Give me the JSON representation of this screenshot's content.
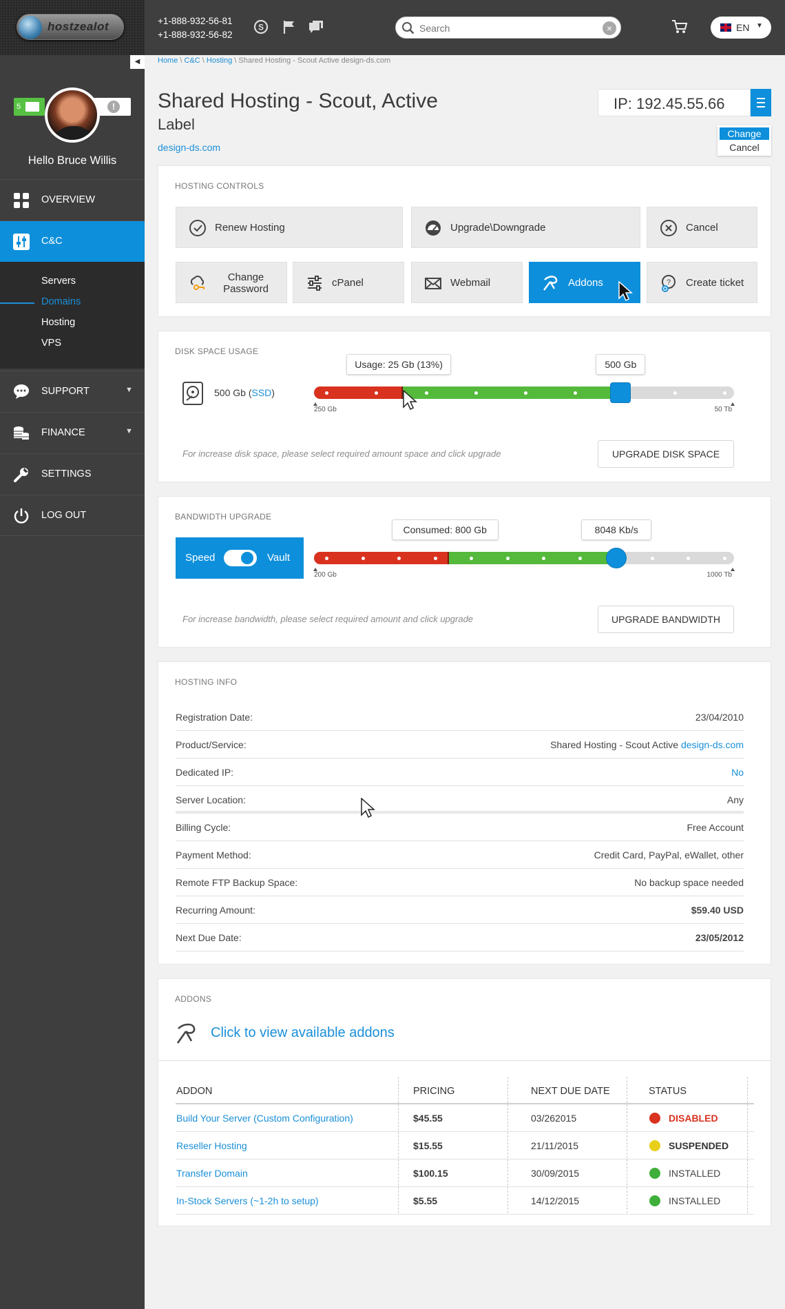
{
  "header": {
    "logo_text": "hostzealot",
    "phones": [
      "+1-888-932-56-81",
      "+1-888-932-56-82"
    ],
    "icons": [
      "skype-icon",
      "flag-icon",
      "chat-icon"
    ],
    "search": {
      "placeholder": "Search"
    },
    "lang": "EN"
  },
  "sidebar": {
    "message_count": "5",
    "greeting": "Hello",
    "user_name": "Bruce Willis",
    "nav": [
      {
        "label": "OVERVIEW"
      },
      {
        "label": "C&C"
      },
      {
        "label": "SUPPORT"
      },
      {
        "label": "FINANCE"
      },
      {
        "label": "SETTINGS"
      },
      {
        "label": "LOG OUT"
      }
    ],
    "subnav": [
      {
        "label": "Servers"
      },
      {
        "label": "Domains"
      },
      {
        "label": "Hosting"
      },
      {
        "label": "VPS"
      }
    ]
  },
  "breadcrumb": {
    "home": "Home",
    "cc": "C&C",
    "hosting": "Hosting",
    "current": "Shared Hosting - Scout Active design-ds.com"
  },
  "page": {
    "title": "Shared Hosting - Scout, Active",
    "subtitle": "Label",
    "domain": "design-ds.com",
    "ip": "IP: 192.45.55.66",
    "ip_menu": {
      "change": "Change",
      "cancel": "Cancel"
    }
  },
  "hosting_controls": {
    "title": "HOSTING CONTROLS",
    "buttons": [
      {
        "label": "Renew Hosting",
        "icon": "check-circle-icon"
      },
      {
        "label": "Upgrade\\Downgrade",
        "icon": "gauge-icon"
      },
      {
        "label": "Cancel",
        "icon": "x-circle-icon"
      },
      {
        "label": "Change Password",
        "icon": "key-cloud-icon"
      },
      {
        "label": "cPanel",
        "icon": "sliders-icon"
      },
      {
        "label": "Webmail",
        "icon": "envelope-icon"
      },
      {
        "label": "Addons",
        "icon": "addons-icon"
      },
      {
        "label": "Create ticket",
        "icon": "ticket-icon"
      }
    ]
  },
  "disk": {
    "title": "DISK SPACE USAGE",
    "size": "500 Gb",
    "type": "SSD",
    "usage_label": "Usage: 25 Gb (13%)",
    "selected_label": "500 Gb",
    "min": "250 Gb",
    "max": "50 Tb",
    "used_fraction": 0.21,
    "selected_fraction": 0.73,
    "hint": "For increase disk space, please select required amount space and click upgrade",
    "button": "UPGRADE DISK SPACE"
  },
  "bandwidth": {
    "title": "BANDWIDTH UPGRADE",
    "toggle_left": "Speed",
    "toggle_right": "Vault",
    "consumed_label": "Consumed: 800 Gb",
    "selected_label": "8048 Kb/s",
    "min": "200 Gb",
    "max": "1000 Tb",
    "used_fraction": 0.32,
    "selected_fraction": 0.72,
    "hint": "For increase bandwidth, please select required amount and click upgrade",
    "button": "UPGRADE BANDWIDTH"
  },
  "hosting_info": {
    "title": "HOSTING INFO",
    "rows": [
      {
        "k": "Registration Date:",
        "v": "23/04/2010"
      },
      {
        "k": "Product/Service:",
        "v": "Shared Hosting - Scout Active",
        "link": "design-ds.com"
      },
      {
        "k": "Dedicated IP:",
        "v": "",
        "link": "No"
      },
      {
        "k": "Server Location:",
        "v": "Any"
      },
      {
        "k": "Billing Cycle:",
        "v": "Free Account"
      },
      {
        "k": "Payment Method:",
        "v": "Credit Card, PayPal, eWallet, other"
      },
      {
        "k": "Remote FTP Backup Space:",
        "v": "No backup space needed"
      },
      {
        "k": "Recurring Amount:",
        "v": "$59.40 USD"
      },
      {
        "k": "Next Due Date:",
        "v": "23/05/2012"
      }
    ]
  },
  "addons": {
    "title": "ADDONS",
    "cta": "Click to view available addons",
    "headers": [
      "ADDON",
      "PRICING",
      "NEXT DUE DATE",
      "STATUS"
    ],
    "rows": [
      {
        "name": "Build Your Server (Custom Configuration)",
        "price": "$45.55",
        "due": "03/262015",
        "status": "DISABLED",
        "color": "#d9321f"
      },
      {
        "name": "Reseller Hosting",
        "price": "$15.55",
        "due": "21/11/2015",
        "status": "SUSPENDED",
        "color": "#e8cf1a"
      },
      {
        "name": "Transfer Domain",
        "price": "$100.15",
        "due": "30/09/2015",
        "status": "INSTALLED",
        "color": "#3fae3a"
      },
      {
        "name": "In-Stock Servers (~1-2h to setup)",
        "price": "$5.55",
        "due": "14/12/2015",
        "status": "INSTALLED",
        "color": "#3fae3a"
      }
    ]
  }
}
